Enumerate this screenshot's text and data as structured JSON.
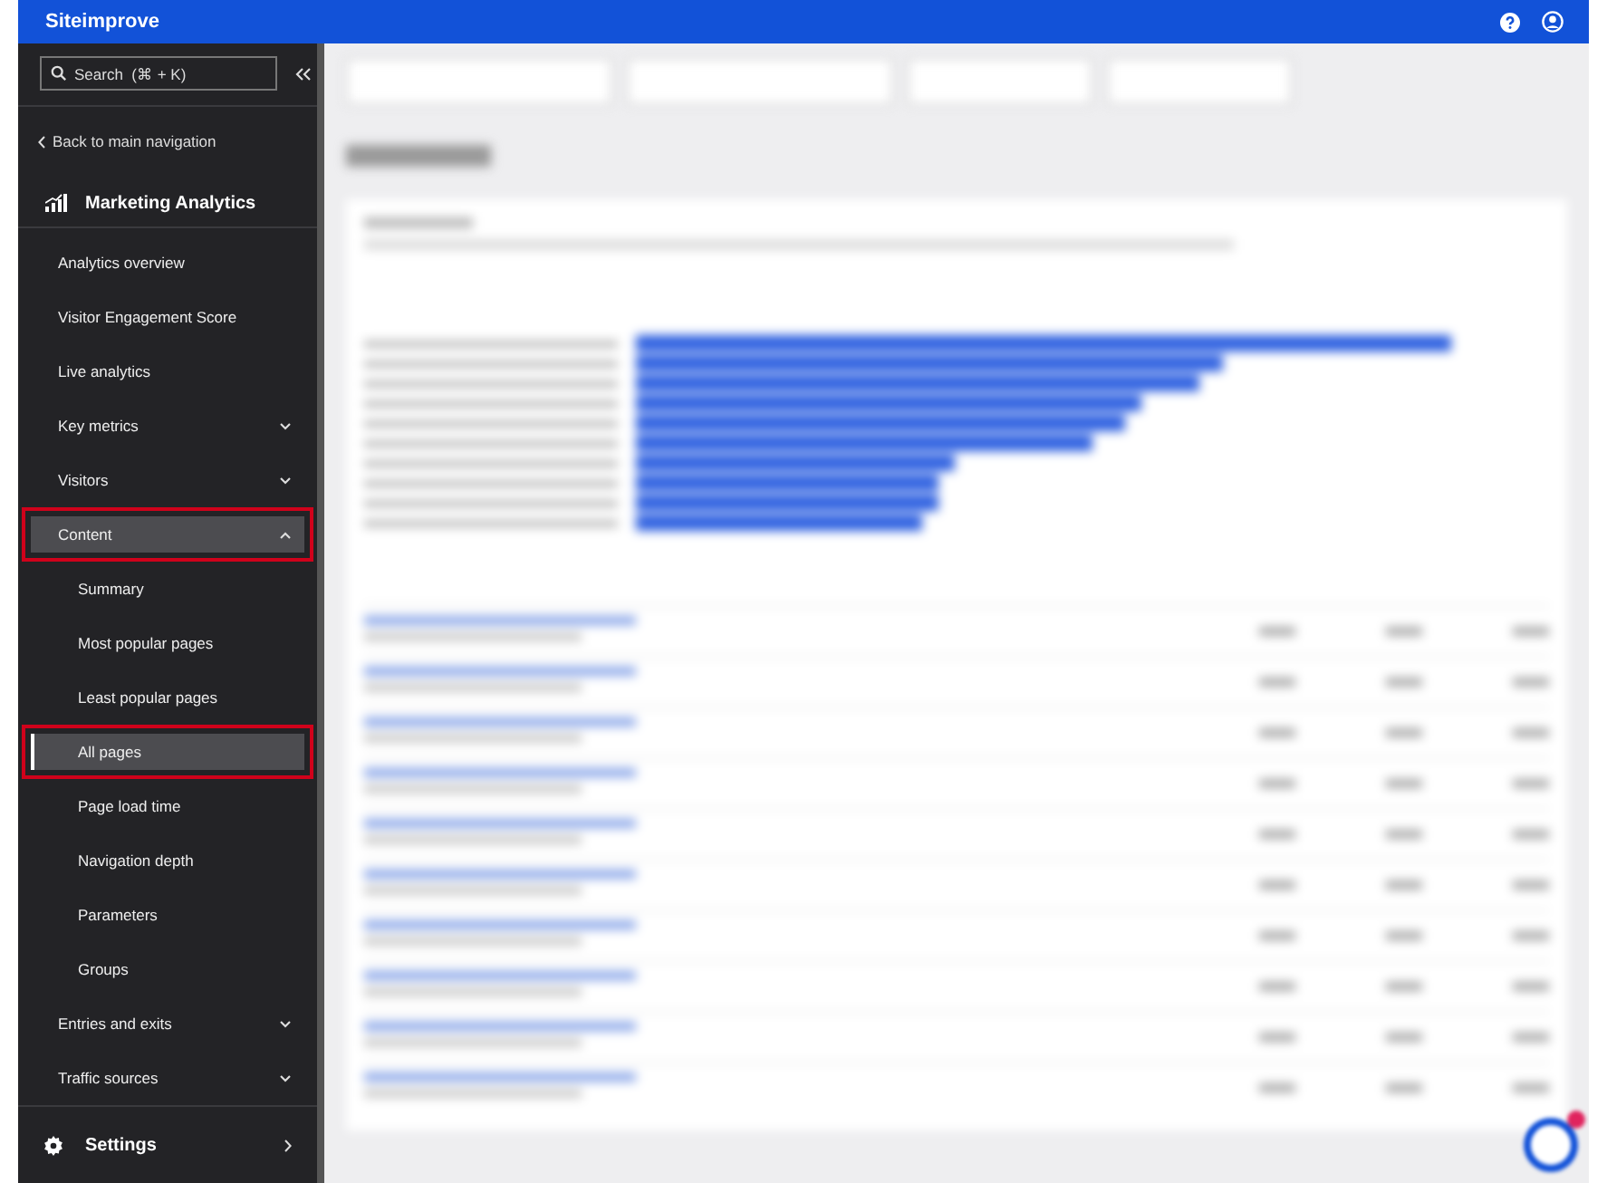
{
  "header": {
    "brand": "Siteimprove"
  },
  "sidebar": {
    "search": {
      "placeholder": "Search  (⌘ + K)"
    },
    "back_link": "Back to main navigation",
    "section_title": "Marketing Analytics",
    "items": [
      {
        "label": "Analytics overview",
        "kind": "link",
        "selected": false,
        "highlighted": false
      },
      {
        "label": "Visitor Engagement Score",
        "kind": "link",
        "selected": false,
        "highlighted": false
      },
      {
        "label": "Live analytics",
        "kind": "link",
        "selected": false,
        "highlighted": false
      },
      {
        "label": "Key metrics",
        "kind": "group",
        "expanded": false,
        "selected": false,
        "highlighted": false
      },
      {
        "label": "Visitors",
        "kind": "group",
        "expanded": false,
        "selected": false,
        "highlighted": false
      },
      {
        "label": "Content",
        "kind": "group",
        "expanded": true,
        "selected": false,
        "highlighted": true,
        "children": [
          {
            "label": "Summary",
            "selected": false,
            "highlighted": false
          },
          {
            "label": "Most popular pages",
            "selected": false,
            "highlighted": false
          },
          {
            "label": "Least popular pages",
            "selected": false,
            "highlighted": false
          },
          {
            "label": "All pages",
            "selected": true,
            "highlighted": true
          },
          {
            "label": "Page load time",
            "selected": false,
            "highlighted": false
          },
          {
            "label": "Navigation depth",
            "selected": false,
            "highlighted": false
          },
          {
            "label": "Parameters",
            "selected": false,
            "highlighted": false
          },
          {
            "label": "Groups",
            "selected": false,
            "highlighted": false
          }
        ]
      },
      {
        "label": "Entries and exits",
        "kind": "group",
        "expanded": false,
        "selected": false,
        "highlighted": false
      },
      {
        "label": "Traffic sources",
        "kind": "group",
        "expanded": false,
        "selected": false,
        "highlighted": false
      }
    ],
    "settings": "Settings"
  }
}
